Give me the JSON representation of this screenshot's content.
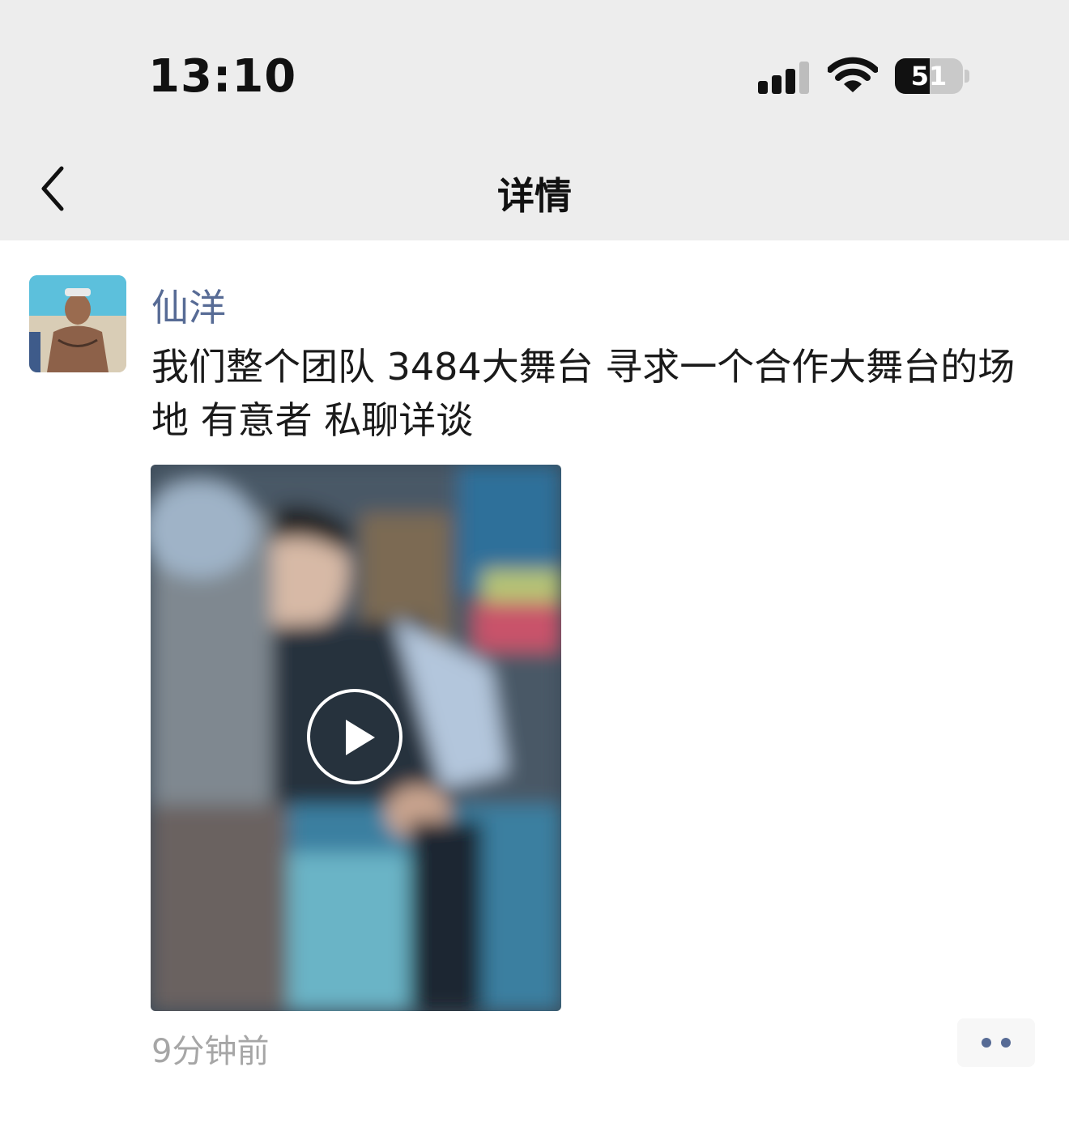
{
  "status_bar": {
    "time": "13:10",
    "battery": "51",
    "battery_level": 0.51
  },
  "nav": {
    "title": "详情",
    "back_icon": "chevron-left-icon"
  },
  "post": {
    "author": "仙洋",
    "text": "我们整个团队 3484大舞台 寻求一个合作大舞台的场地 有意者 私聊详谈",
    "media_type": "video",
    "timestamp": "9分钟前"
  },
  "colors": {
    "author_link": "#576b95",
    "nav_bg": "#ededed",
    "timestamp": "#a6a6a6"
  }
}
